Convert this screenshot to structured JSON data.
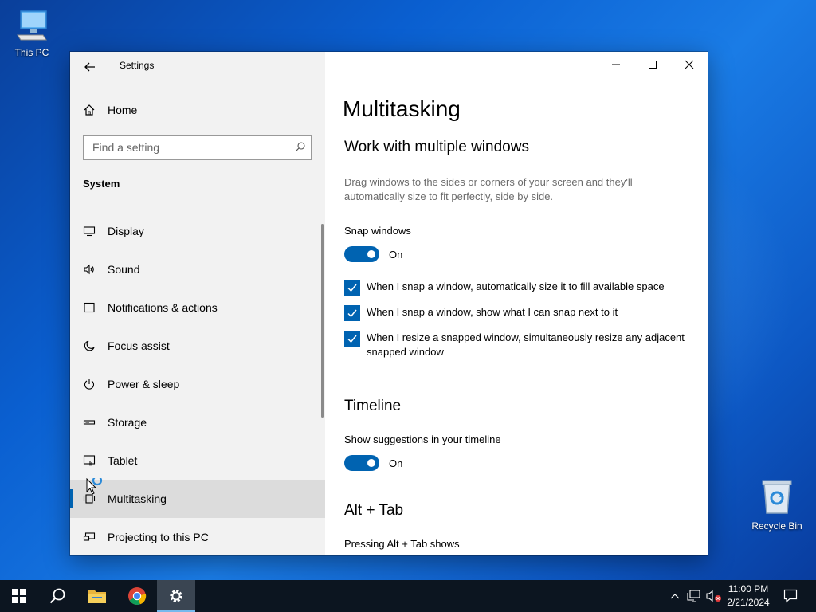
{
  "desktop": {
    "icons": [
      {
        "label": "This PC"
      },
      {
        "label": "Recycle Bin"
      }
    ]
  },
  "window": {
    "app_title": "Settings",
    "home_label": "Home",
    "search": {
      "placeholder": "Find a setting",
      "value": ""
    },
    "section_label": "System",
    "nav_items": [
      {
        "label": "Display",
        "icon": "monitor-icon"
      },
      {
        "label": "Sound",
        "icon": "speaker-icon"
      },
      {
        "label": "Notifications & actions",
        "icon": "notifications-icon"
      },
      {
        "label": "Focus assist",
        "icon": "moon-icon"
      },
      {
        "label": "Power & sleep",
        "icon": "power-icon"
      },
      {
        "label": "Storage",
        "icon": "storage-icon"
      },
      {
        "label": "Tablet",
        "icon": "tablet-icon"
      },
      {
        "label": "Multitasking",
        "icon": "multitasking-icon",
        "selected": true
      },
      {
        "label": "Projecting to this PC",
        "icon": "projector-icon"
      }
    ]
  },
  "content": {
    "page_title": "Multitasking",
    "snap": {
      "heading": "Work with multiple windows",
      "description": "Drag windows to the sides or corners of your screen and they'll automatically size to fit perfectly, side by side.",
      "toggle_label": "Snap windows",
      "toggle_state": "On",
      "options": [
        {
          "label": "When I snap a window, automatically size it to fill available space",
          "checked": true
        },
        {
          "label": "When I snap a window, show what I can snap next to it",
          "checked": true
        },
        {
          "label": "When I resize a snapped window, simultaneously resize any adjacent snapped window",
          "checked": true
        }
      ]
    },
    "timeline": {
      "heading": "Timeline",
      "toggle_label": "Show suggestions in your timeline",
      "toggle_state": "On"
    },
    "alttab": {
      "heading": "Alt + Tab",
      "label": "Pressing Alt + Tab shows"
    }
  },
  "taskbar": {
    "time": "11:00 PM",
    "date": "2/21/2024"
  },
  "colors": {
    "accent": "#0063b1",
    "sidebar_bg": "#f2f2f2",
    "taskbar_bg": "#0c1520"
  }
}
